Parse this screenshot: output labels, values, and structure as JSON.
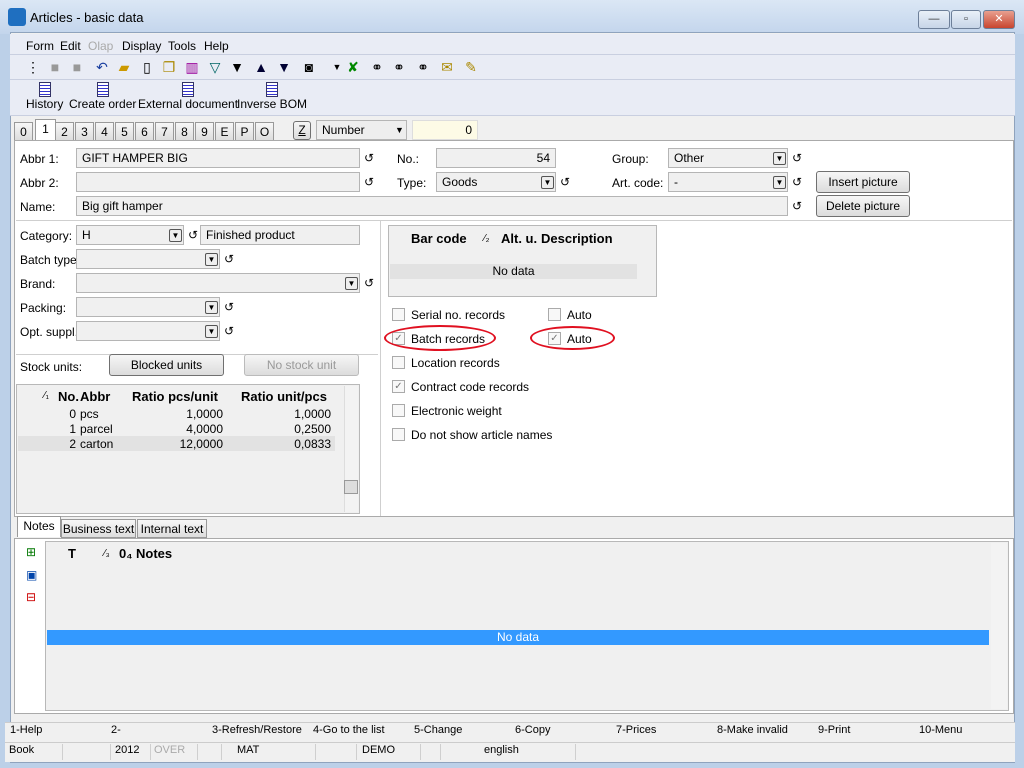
{
  "window": {
    "title": "Articles - basic data",
    "minimize": "—",
    "maximize": "▫",
    "close": "✕"
  },
  "menu": [
    "Form",
    "Edit",
    "Olap",
    "Display",
    "Tools",
    "Help"
  ],
  "toolbar_icons": [
    "tree-icon",
    "save-icon",
    "save-as-icon",
    "undo-icon",
    "open-folder-icon",
    "new-document-icon",
    "copy-icon",
    "book-icon",
    "filter-icon",
    "filter-list-icon",
    "arrow-up-icon",
    "arrow-down-icon",
    "camera-icon",
    "dropdown-arrow-icon",
    "excel-export-icon",
    "binoculars-icon",
    "binoculars-next-icon",
    "binoculars-prev-icon",
    "mail-icon",
    "edit-notes-icon"
  ],
  "actions": [
    "History",
    "Create order",
    "External document",
    "Inverse BOM"
  ],
  "tabs": [
    "0",
    "1",
    "2",
    "3",
    "4",
    "5",
    "6",
    "7",
    "8",
    "9",
    "E",
    "P",
    "O"
  ],
  "active_tab": "1",
  "sort": {
    "z_label": "Z",
    "field": "Number",
    "value": "0"
  },
  "form": {
    "abbr1_label": "Abbr 1:",
    "abbr1": "GIFT HAMPER BIG",
    "abbr2_label": "Abbr 2:",
    "abbr2": "",
    "name_label": "Name:",
    "name": "Big gift hamper",
    "no_label": "No.:",
    "no": "54",
    "type_label": "Type:",
    "type": "Goods",
    "group_label": "Group:",
    "group": "Other",
    "artcode_label": "Art. code:",
    "artcode": "-",
    "insert_picture": "Insert picture",
    "delete_picture": "Delete picture",
    "category_label": "Category:",
    "category": "H",
    "category_desc": "Finished product",
    "batch_type_label": "Batch type:",
    "brand_label": "Brand:",
    "packing_label": "Packing:",
    "opt_suppl_label": "Opt. suppl.:",
    "stock_units_label": "Stock units:",
    "blocked_units": "Blocked units",
    "no_stock_unit": "No stock unit"
  },
  "units_grid": {
    "sort_mark": "⁄₁",
    "headers": [
      "No.",
      "Abbr",
      "Ratio pcs/unit",
      "Ratio unit/pcs"
    ],
    "rows": [
      [
        "0",
        "pcs",
        "1,0000",
        "1,0000"
      ],
      [
        "1",
        "parcel",
        "4,0000",
        "0,2500"
      ],
      [
        "2",
        "carton",
        "12,0000",
        "0,0833"
      ]
    ]
  },
  "barcode_grid": {
    "headers": [
      "Bar code",
      "⁄₂",
      "Alt. u.",
      "Description"
    ],
    "empty": "No data"
  },
  "checks": [
    {
      "label": "Serial no. records",
      "checked": false,
      "auto_label": "Auto",
      "auto_checked": false
    },
    {
      "label": "Batch records",
      "checked": true,
      "auto_label": "Auto",
      "auto_checked": true
    },
    {
      "label": "Location records",
      "checked": false
    },
    {
      "label": "Contract code records",
      "checked": true
    },
    {
      "label": "Electronic weight",
      "checked": false
    },
    {
      "label": "Do not show article names",
      "checked": false
    }
  ],
  "highlight_color": "#e01020",
  "notes_tabs": [
    "Notes",
    "Business text",
    "Internal text"
  ],
  "notes_grid": {
    "headers": [
      "T",
      "⁄₃",
      "0₄",
      "Notes"
    ],
    "empty": "No data"
  },
  "fkeys": [
    "1-Help",
    "2-",
    "3-Refresh/Restore",
    "4-Go to the list",
    "5-Change",
    "6-Copy",
    "7-Prices",
    "8-Make invalid",
    "9-Print",
    "10-Menu"
  ],
  "status": [
    "Book",
    "2012",
    "OVER",
    "MAT",
    "DEMO",
    "english"
  ]
}
